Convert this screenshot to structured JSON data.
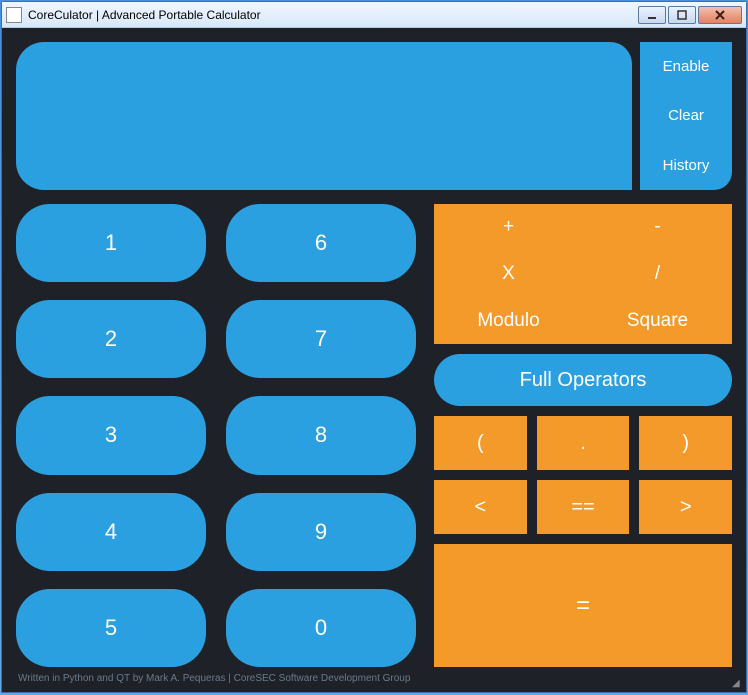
{
  "window": {
    "title": "CoreCulator | Advanced Portable Calculator"
  },
  "display": {
    "value": ""
  },
  "sideButtons": {
    "enable": "Enable",
    "clear": "Clear",
    "history": "History"
  },
  "numpad": {
    "b1": "1",
    "b6": "6",
    "b2": "2",
    "b7": "7",
    "b3": "3",
    "b8": "8",
    "b4": "4",
    "b9": "9",
    "b5": "5",
    "b0": "0"
  },
  "op_top": {
    "plus": "+",
    "minus": "-",
    "mult": "X",
    "div": "/",
    "modulo": "Modulo",
    "square": "Square"
  },
  "full_operators": "Full Operators",
  "parens": {
    "open": "(",
    "dot": ".",
    "close": ")"
  },
  "comp": {
    "lt": "<",
    "eq": "==",
    "gt": ">"
  },
  "equals": "=",
  "footer": "Written in Python and QT by Mark A. Pequeras | CoreSEC Software Development Group"
}
